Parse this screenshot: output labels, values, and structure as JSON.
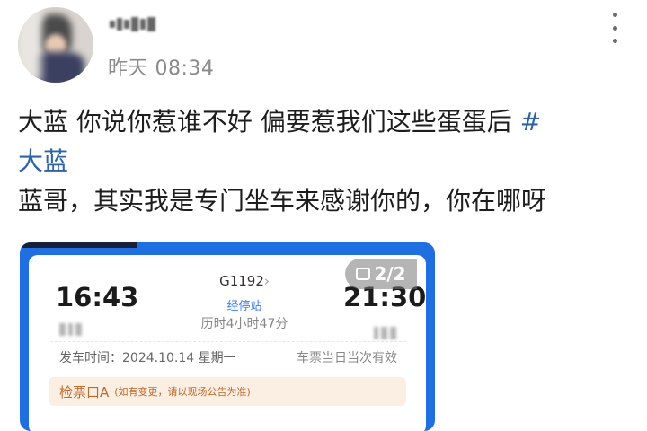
{
  "post": {
    "time": "昨天 08:34",
    "text_line1": "大蓝 你说你惹谁不好 偏要惹我们这些蛋蛋后 ",
    "hashtag_part1": "#",
    "hashtag_part2": "大蓝",
    "text_line2": "蓝哥，其实我是专门坐车来感谢你的，你在哪呀"
  },
  "ticket": {
    "departure_time": "16:43",
    "arrival_time": "21:30",
    "train_number": "G1192",
    "chevron": "›",
    "stops_link": "经停站",
    "duration": "历时4小时47分",
    "departure_date": "发车时间：2024.10.14 星期一",
    "validity": "车票当日当次有效",
    "gate": "检票口A",
    "gate_note": "(如有变更，请以现场公告为准)"
  },
  "image_badge": "2/2",
  "icons": {
    "more": "more-vertical-icon",
    "gallery": "image-gallery-icon"
  },
  "colors": {
    "hashtag": "#2f63a6",
    "card_border": "#1f6fe0",
    "link": "#3a7ef0",
    "gate_bg": "#fbeee3",
    "gate_text": "#c06a2a"
  }
}
